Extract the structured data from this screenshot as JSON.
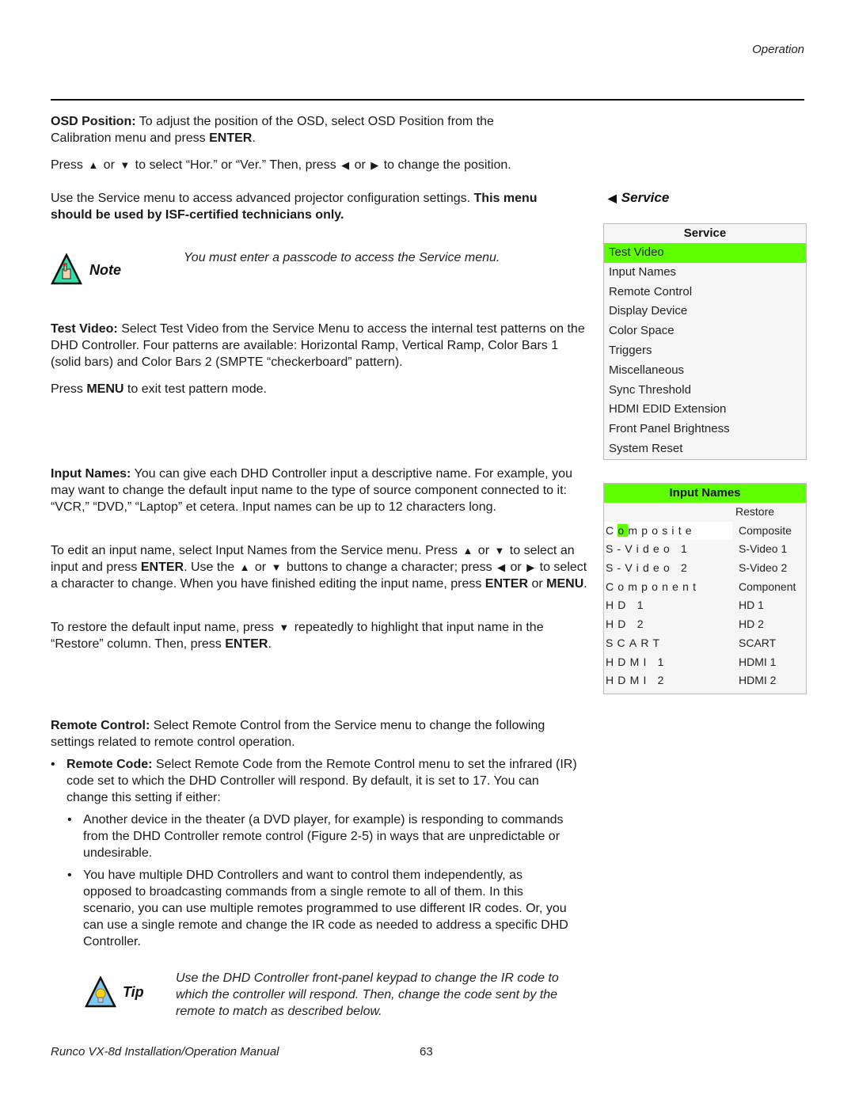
{
  "header": {
    "section": "Operation"
  },
  "osd_position": {
    "label": "OSD Position:",
    "text1": " To adjust the position of the OSD, select OSD Position from the Calibration menu and press ",
    "enter": "ENTER",
    "end": "."
  },
  "osd_press": {
    "press": "Press ",
    "or1": " or ",
    "mid": " to select “Hor.” or “Ver.” Then, press ",
    "or2": " or ",
    "end": " to change the position."
  },
  "service_intro": {
    "text": "Use the Service menu to access advanced projector configuration settings. ",
    "bold": "This menu should be used by ISF-certified technicians only."
  },
  "note": {
    "label": "Note",
    "text": "You must enter a passcode to access the Service menu."
  },
  "test_video": {
    "label": "Test Video:",
    "text": " Select Test Video from the Service Menu to access the internal test patterns on the DHD Controller. Four patterns are available: Horizontal Ramp, Vertical Ramp, Color Bars 1 (solid bars) and Color Bars 2 (SMPTE “checkerboard” pattern)."
  },
  "press_menu": {
    "press": "Press ",
    "menu": "MENU",
    "end": " to exit test pattern mode."
  },
  "input_names": {
    "label": "Input Names:",
    "text": " You can give each DHD Controller input a descriptive name. For example, you may want to change the default input name to the type of source component connected to it: “VCR,” “DVD,” “Laptop” et cetera. Input names can be up to 12 characters long."
  },
  "edit_input": {
    "t1": "To edit an input name, select Input Names from the Service menu. Press ",
    "or1": " or ",
    "t2": " to select an input and press ",
    "enter1": "ENTER",
    "t3": ". Use the ",
    "or2": " or ",
    "t4": " buttons to change a character; press ",
    "or3": " or ",
    "t5": " to select a character to change. When you have finished editing the input name, press ",
    "enter2": "ENTER",
    "or4": " or ",
    "menu": "MENU",
    "end": "."
  },
  "restore_input": {
    "t1": "To restore the default input name, press ",
    "t2": " repeatedly to highlight that input name in the “Restore” column. Then, press ",
    "enter": "ENTER",
    "end": "."
  },
  "remote_control": {
    "label": "Remote Control:",
    "text": " Select Remote Control from the Service menu to change the following settings related to remote control operation."
  },
  "remote_code": {
    "label": "Remote Code:",
    "text": " Select Remote Code from the Remote Control menu to set the infrared (IR) code set to which the DHD Controller will respond. By default, it is set to 17. You can change this setting if either:",
    "sub_items": [
      "Another device in the theater (a DVD player, for example) is responding to commands from the DHD Controller remote control (Figure 2-5) in ways that are unpredictable or undesirable.",
      "You have multiple DHD Controllers and want to control them independently, as opposed to broadcasting commands from a single remote to all of them. In this scenario, you can use multiple remotes programmed to use different IR codes. Or, you can use a single remote and change the IR code as needed to address a specific DHD Controller."
    ]
  },
  "tip": {
    "label": "Tip",
    "text": "Use the DHD Controller front-panel keypad to change the IR code to which the controller will respond. Then, change the code sent by the remote to match as described below."
  },
  "service_section": {
    "heading": "Service"
  },
  "service_menu": {
    "title": "Service",
    "selected_index": 0,
    "items": [
      "Test Video",
      "Input Names",
      "Remote Control",
      "Display Device",
      "Color Space",
      "Triggers",
      "Miscellaneous",
      "Sync Threshold",
      "HDMI EDID Extension",
      "Front Panel Brightness",
      "System Reset"
    ]
  },
  "input_names_menu": {
    "title": "Input Names",
    "restore_header": "Restore",
    "active_row": 0,
    "cursor_char_index": 1,
    "rows": [
      {
        "name": "Composite",
        "restore": "Composite"
      },
      {
        "name": "S-Video 1",
        "restore": "S-Video 1"
      },
      {
        "name": "S-Video 2",
        "restore": "S-Video 2"
      },
      {
        "name": "Component",
        "restore": "Component"
      },
      {
        "name": "HD  1",
        "restore": "HD 1"
      },
      {
        "name": "HD  2",
        "restore": "HD 2"
      },
      {
        "name": "SCART",
        "restore": "SCART"
      },
      {
        "name": "HDMI  1",
        "restore": "HDMI 1"
      },
      {
        "name": "HDMI  2",
        "restore": "HDMI 2"
      }
    ]
  },
  "icons": {
    "up": "▲",
    "down": "▼",
    "left": "◀",
    "right": "▶",
    "back": "◀"
  },
  "colors": {
    "highlight": "#5eff00",
    "note_icon": "#33dda8",
    "tip_icon": "#7fc8f0"
  },
  "footer": {
    "manual_title": "Runco VX-8d Installation/Operation Manual",
    "page_number": "63"
  }
}
